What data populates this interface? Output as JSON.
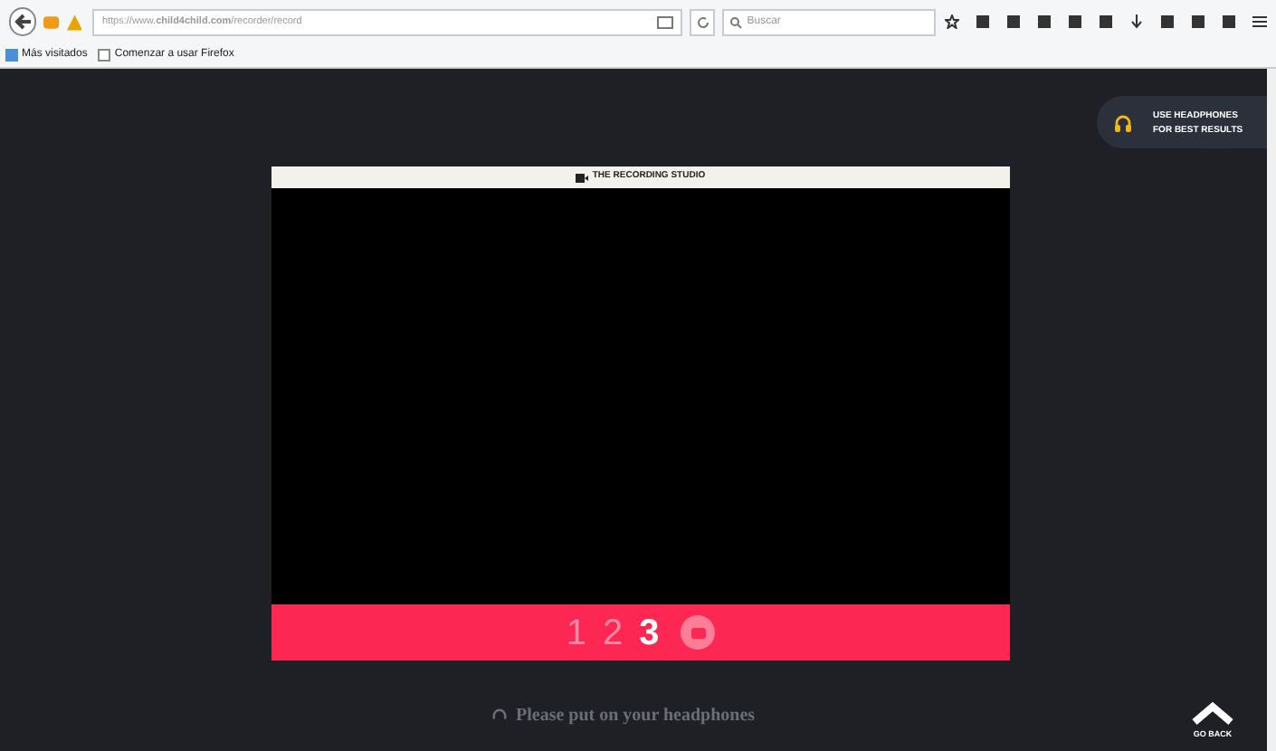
{
  "browser": {
    "url": "https://www.**child4child.com**/recorder/record",
    "search": {
      "placeholder": "Buscar"
    },
    "bookmarks": [
      {
        "label": "Más visitados",
        "kind": "folder"
      },
      {
        "label": "Comenzar a usar Firefox",
        "kind": "page"
      }
    ]
  },
  "tip": {
    "line_1": "USE HEADPHONES",
    "line_2": "FOR BEST RESULTS"
  },
  "studio": {
    "title": "THE RECORDING STUDIO",
    "countdown": [
      {
        "label": "1",
        "selected": false
      },
      {
        "label": "2",
        "selected": false
      },
      {
        "label": "3",
        "selected": true
      }
    ]
  },
  "hint": "Please put on your headphones",
  "go_back": "GO BACK"
}
